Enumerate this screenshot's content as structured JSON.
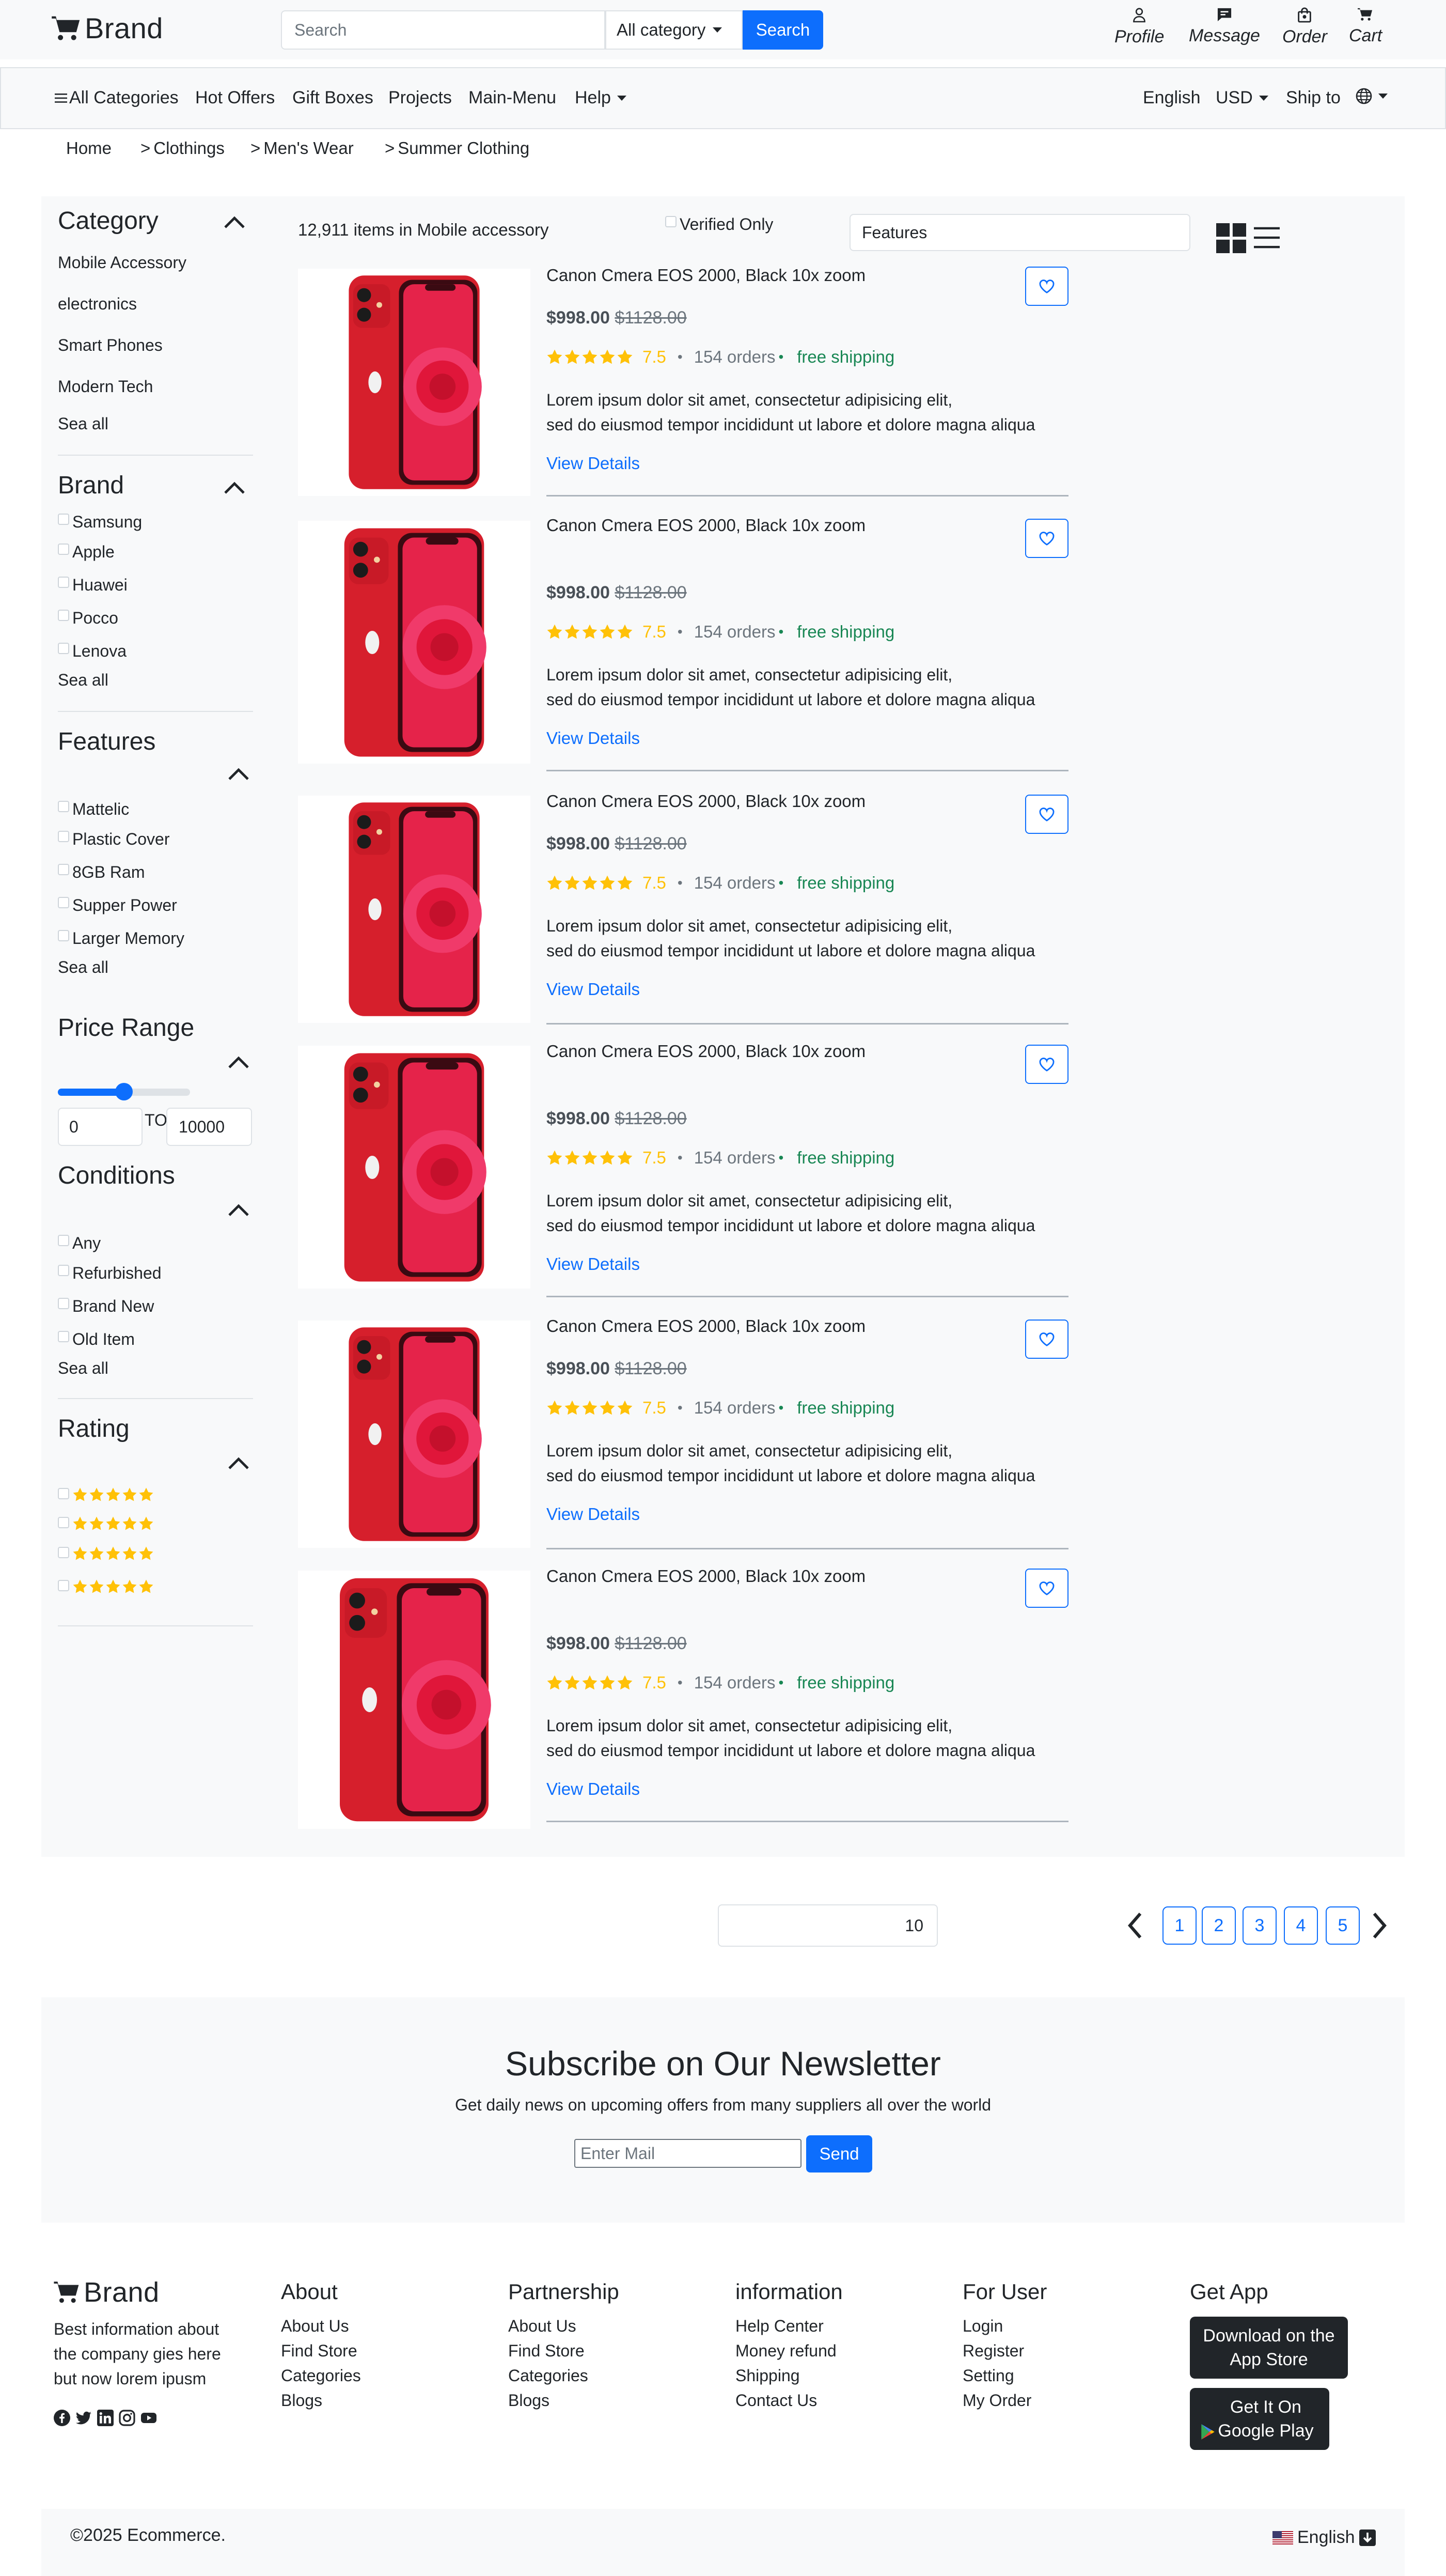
{
  "header": {
    "brand": "Brand",
    "search_placeholder": "Search",
    "category_select": "All category",
    "search_button": "Search",
    "links": [
      "Profile",
      "Message",
      "Order",
      "Cart"
    ]
  },
  "nav": {
    "all_categories": "All Categories",
    "items": [
      "Hot Offers",
      "Gift Boxes",
      "Projects",
      "Main-Menu",
      "Help"
    ],
    "language": "English",
    "currency": "USD",
    "ship_to": "Ship to"
  },
  "breadcrumb": [
    "Home",
    "Clothings",
    "Men's Wear",
    "Summer Clothing"
  ],
  "sidebar": {
    "category": {
      "title": "Category",
      "items": [
        "Mobile Accessory",
        "electronics",
        "Smart Phones",
        "Modern Tech"
      ],
      "see_all": "Sea all"
    },
    "brand": {
      "title": "Brand",
      "items": [
        "Samsung",
        "Apple",
        "Huawei",
        "Pocco",
        "Lenova"
      ],
      "see_all": "Sea all"
    },
    "features": {
      "title": "Features",
      "items": [
        "Mattelic",
        "Plastic Cover",
        "8GB Ram",
        "Supper Power",
        "Larger Memory"
      ],
      "see_all": "Sea all"
    },
    "price": {
      "title": "Price Range",
      "slider_fraction": 0.5,
      "min": "0",
      "to": "TO",
      "max": "10000"
    },
    "conditions": {
      "title": "Conditions",
      "items": [
        "Any",
        "Refurbished",
        "Brand New",
        "Old Item"
      ],
      "see_all": "Sea all"
    },
    "rating": {
      "title": "Rating",
      "rows": 4
    }
  },
  "results": {
    "count_text": "12,911 items in Mobile accessory",
    "verified_label": "Verified Only",
    "features_select": "Features"
  },
  "product_template": {
    "title": "Canon Cmera EOS 2000, Black 10x zoom",
    "price": "$998.00",
    "old_price": "$1128.00",
    "rating": "7.5",
    "orders": "154 orders",
    "shipping": "free shipping",
    "desc_line1": "Lorem ipsum dolor sit amet, consectetur adipisicing elit,",
    "desc_line2": "sed do eiusmod tempor incididunt ut labore et dolore magna aliqua",
    "link": "View Details"
  },
  "products": [
    {
      "title": "Canon Cmera EOS 2000, Black 10x zoom",
      "price": "$998.00",
      "old_price": "$1128.00",
      "rating": "7.5",
      "orders": "154 orders",
      "shipping": "free shipping",
      "desc_line1": "Lorem ipsum dolor sit amet, consectetur adipisicing elit,",
      "desc_line2": "sed do eiusmod tempor incididunt ut labore et dolore magna aliqua",
      "link": "View Details"
    },
    {
      "title": "Canon Cmera EOS 2000, Black 10x zoom",
      "price": "$998.00",
      "old_price": "$1128.00",
      "rating": "7.5",
      "orders": "154 orders",
      "shipping": "free shipping",
      "desc_line1": "Lorem ipsum dolor sit amet, consectetur adipisicing elit,",
      "desc_line2": "sed do eiusmod tempor incididunt ut labore et dolore magna aliqua",
      "link": "View Details"
    },
    {
      "title": "Canon Cmera EOS 2000, Black 10x zoom",
      "price": "$998.00",
      "old_price": "$1128.00",
      "rating": "7.5",
      "orders": "154 orders",
      "shipping": "free shipping",
      "desc_line1": "Lorem ipsum dolor sit amet, consectetur adipisicing elit,",
      "desc_line2": "sed do eiusmod tempor incididunt ut labore et dolore magna aliqua",
      "link": "View Details"
    },
    {
      "title": "Canon Cmera EOS 2000, Black 10x zoom",
      "price": "$998.00",
      "old_price": "$1128.00",
      "rating": "7.5",
      "orders": "154 orders",
      "shipping": "free shipping",
      "desc_line1": "Lorem ipsum dolor sit amet, consectetur adipisicing elit,",
      "desc_line2": "sed do eiusmod tempor incididunt ut labore et dolore magna aliqua",
      "link": "View Details"
    },
    {
      "title": "Canon Cmera EOS 2000, Black 10x zoom",
      "price": "$998.00",
      "old_price": "$1128.00",
      "rating": "7.5",
      "orders": "154 orders",
      "shipping": "free shipping",
      "desc_line1": "Lorem ipsum dolor sit amet, consectetur adipisicing elit,",
      "desc_line2": "sed do eiusmod tempor incididunt ut labore et dolore magna aliqua",
      "link": "View Details"
    },
    {
      "title": "Canon Cmera EOS 2000, Black 10x zoom",
      "price": "$998.00",
      "old_price": "$1128.00",
      "rating": "7.5",
      "orders": "154 orders",
      "shipping": "free shipping",
      "desc_line1": "Lorem ipsum dolor sit amet, consectetur adipisicing elit,",
      "desc_line2": "sed do eiusmod tempor incididunt ut labore et dolore magna aliqua",
      "link": "View Details"
    }
  ],
  "pagination": {
    "per_page": "10",
    "pages": [
      "1",
      "2",
      "3",
      "4",
      "5"
    ]
  },
  "newsletter": {
    "title": "Subscribe on Our Newsletter",
    "subtitle": "Get daily news on upcoming offers from many suppliers all over the world",
    "placeholder": "Enter Mail",
    "button": "Send"
  },
  "footer": {
    "brand": "Brand",
    "about_text_lines": [
      "Best information about",
      "the company gies here",
      "but now lorem ipusm"
    ],
    "columns": [
      {
        "title": "About",
        "links": [
          "About Us",
          "Find Store",
          "Categories",
          "Blogs"
        ]
      },
      {
        "title": "Partnership",
        "links": [
          "About Us",
          "Find Store",
          "Categories",
          "Blogs"
        ]
      },
      {
        "title": "information",
        "links": [
          "Help Center",
          "Money refund",
          "Shipping",
          "Contact Us"
        ]
      },
      {
        "title": "For User",
        "links": [
          "Login",
          "Register",
          "Setting",
          "My Order"
        ]
      }
    ],
    "get_app": "Get App",
    "app_store_lines": [
      "Download on the",
      "App Store"
    ],
    "google_play_lines": [
      "Get It On",
      "Google Play"
    ],
    "copyright": "©2025 Ecommerce.",
    "language": "English"
  },
  "colors": {
    "primary": "#0d6efd",
    "star": "#ffc107",
    "success": "#198754",
    "panel": "#f8f9fa",
    "dark": "#212529"
  }
}
